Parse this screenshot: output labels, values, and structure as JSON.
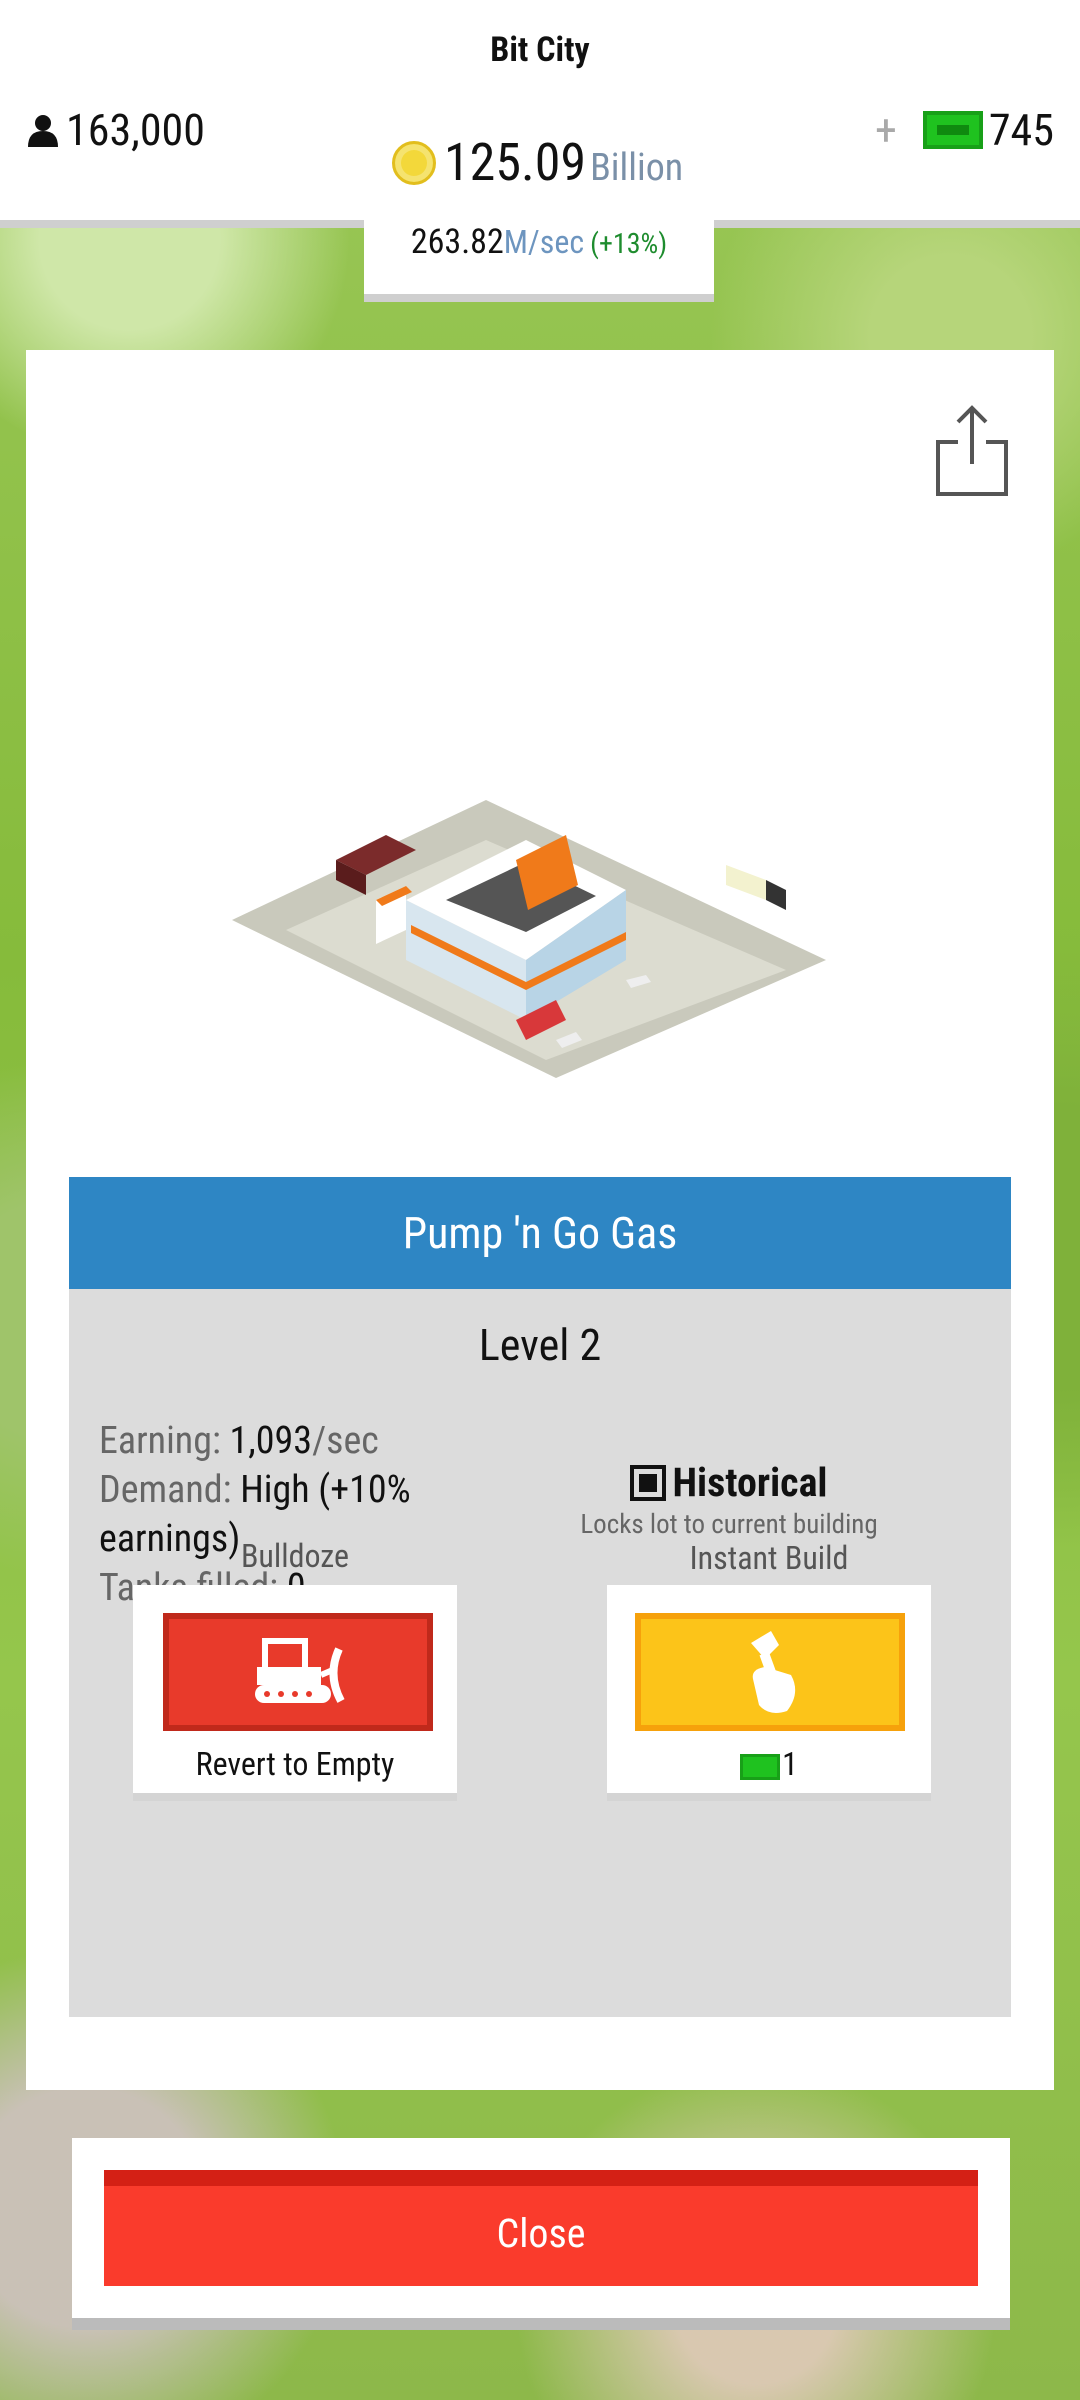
{
  "header": {
    "title": "Bit City",
    "population": "163,000",
    "money_amount": "125.09",
    "money_unit": "Billion",
    "plus": "+",
    "bux": "745",
    "rate_value": "263.82",
    "rate_unit": "M/sec",
    "rate_bonus": "(+13%)"
  },
  "panel": {
    "building_name": "Pump 'n Go Gas",
    "level": "Level 2",
    "stats": {
      "earning_label": "Earning:",
      "earning_value": "1,093",
      "earning_unit": "/sec",
      "demand_label": "Demand:",
      "demand_value": "High (+10% earnings)",
      "tanks_label": "Tanks filled:",
      "tanks_value": "0"
    },
    "historical": {
      "label": "Historical",
      "sub": "Locks lot to current building",
      "checked": true
    },
    "actions": {
      "bulldoze_label": "Bulldoze",
      "bulldoze_caption": "Revert to Empty",
      "instant_label": "Instant Build",
      "instant_cost": "1"
    }
  },
  "footer": {
    "close_label": "Close"
  },
  "colors": {
    "name_bar": "#2e86c4",
    "bulldoze": "#e83a2b",
    "instant": "#fcc419",
    "close": "#fa3b2c",
    "bux_green": "#1fc21f"
  }
}
